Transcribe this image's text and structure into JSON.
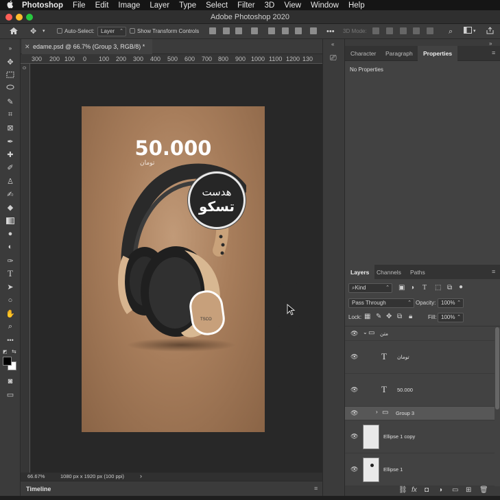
{
  "menubar": {
    "apple": "",
    "app": "Photoshop",
    "items": [
      "File",
      "Edit",
      "Image",
      "Layer",
      "Type",
      "Select",
      "Filter",
      "3D",
      "View",
      "Window",
      "Help"
    ]
  },
  "window": {
    "title": "Adobe Photoshop 2020"
  },
  "options": {
    "auto_select_label": "Auto-Select:",
    "auto_select_target": "Layer",
    "transform_label": "Show Transform Controls",
    "mode_3d_label": "3D Mode:"
  },
  "document": {
    "tab_title": "edame.psd @ 66.7% (Group 3, RGB/8) *",
    "ruler_ticks": [
      "300",
      "200",
      "100",
      "0",
      "100",
      "200",
      "300",
      "400",
      "500",
      "600",
      "700",
      "800",
      "900",
      "1000",
      "1100",
      "1200",
      "130"
    ],
    "zoom": "66.67%",
    "dimensions": "1080 px x 1920 px (100 ppi)"
  },
  "artwork": {
    "price": "50.000",
    "currency": "تومان",
    "badge_line1": "هدست",
    "badge_line2": "تسکو",
    "brand_mark": "TSCO"
  },
  "timeline": {
    "label": "Timeline"
  },
  "props_panel": {
    "tabs": [
      "Character",
      "Paragraph",
      "Properties"
    ],
    "active_tab": "Properties",
    "empty_text": "No Properties"
  },
  "layers_panel": {
    "tabs": [
      "Layers",
      "Channels",
      "Paths"
    ],
    "active_tab": "Layers",
    "filter_kind": "Kind",
    "blend_mode": "Pass Through",
    "opacity_label": "Opacity:",
    "opacity_value": "100%",
    "lock_label": "Lock:",
    "fill_label": "Fill:",
    "fill_value": "100%",
    "layers": [
      {
        "name": "متن",
        "type": "group"
      },
      {
        "name": "تومان",
        "type": "text"
      },
      {
        "name": "50.000",
        "type": "text"
      },
      {
        "name": "Group 3",
        "type": "group"
      },
      {
        "name": "Ellipse 1 copy",
        "type": "shape"
      },
      {
        "name": "Ellipse 1",
        "type": "shape"
      }
    ]
  },
  "colors": {
    "artboard": "#a77d5b",
    "panel": "#424242",
    "ui_dark": "#3b3b3b",
    "selected_layer": "#575757"
  }
}
